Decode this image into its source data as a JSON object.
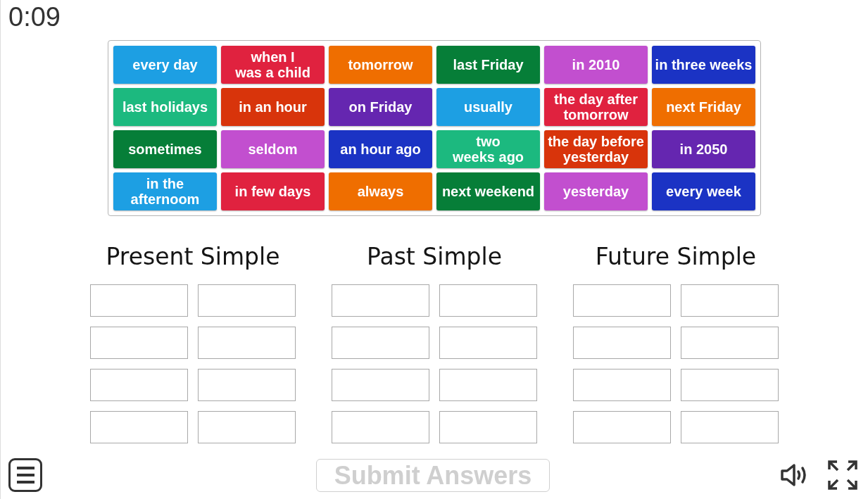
{
  "timer": "0:09",
  "tiles": [
    {
      "text": "every day",
      "color": "#1d9fe3"
    },
    {
      "text": "when I\nwas a child",
      "color": "#e0223f"
    },
    {
      "text": "tomorrow",
      "color": "#ef6e00"
    },
    {
      "text": "last Friday",
      "color": "#067e38"
    },
    {
      "text": "in 2010",
      "color": "#c24fcf"
    },
    {
      "text": "in three weeks",
      "color": "#1b33c4"
    },
    {
      "text": "last holidays",
      "color": "#1cb97f"
    },
    {
      "text": "in an hour",
      "color": "#d8340b"
    },
    {
      "text": "on Friday",
      "color": "#6526b0"
    },
    {
      "text": "usually",
      "color": "#1d9fe3"
    },
    {
      "text": "the day after\ntomorrow",
      "color": "#e0223f"
    },
    {
      "text": "next Friday",
      "color": "#ef6e00"
    },
    {
      "text": "sometimes",
      "color": "#067e38"
    },
    {
      "text": "seldom",
      "color": "#c24fcf"
    },
    {
      "text": "an hour ago",
      "color": "#1b33c4"
    },
    {
      "text": "two\nweeks ago",
      "color": "#1cb97f"
    },
    {
      "text": "the day before\nyesterday",
      "color": "#d8340b"
    },
    {
      "text": "in 2050",
      "color": "#6526b0"
    },
    {
      "text": "in the\nafternoom",
      "color": "#1d9fe3"
    },
    {
      "text": "in few days",
      "color": "#e0223f"
    },
    {
      "text": "always",
      "color": "#ef6e00"
    },
    {
      "text": "next weekend",
      "color": "#067e38"
    },
    {
      "text": "yesterday",
      "color": "#c24fcf"
    },
    {
      "text": "every week",
      "color": "#1b33c4"
    }
  ],
  "groups": [
    {
      "title": "Present Simple",
      "slots": [
        {
          "kind": "blank"
        },
        {
          "kind": "blank"
        },
        {
          "kind": "blank"
        },
        {
          "kind": "blank"
        },
        {
          "kind": "blank"
        },
        {
          "kind": "blank"
        },
        {
          "kind": "blank"
        },
        {
          "kind": "blank"
        }
      ]
    },
    {
      "title": "Past Simple",
      "slots": [
        {
          "kind": "blank"
        },
        {
          "kind": "blank"
        },
        {
          "kind": "blank"
        },
        {
          "kind": "blank"
        },
        {
          "kind": "blank"
        },
        {
          "kind": "blank"
        },
        {
          "kind": "blank"
        },
        {
          "kind": "blank"
        }
      ]
    },
    {
      "title": "Future Simple",
      "slots": [
        {
          "kind": "blank"
        },
        {
          "kind": "blank"
        },
        {
          "kind": "blank"
        },
        {
          "kind": "blank"
        },
        {
          "kind": "blank"
        },
        {
          "kind": "blank"
        },
        {
          "kind": "blank"
        },
        {
          "kind": "blank"
        }
      ]
    }
  ],
  "submit": {
    "label": "Submit Answers",
    "disabled": true
  },
  "sound": {
    "muted": false
  }
}
